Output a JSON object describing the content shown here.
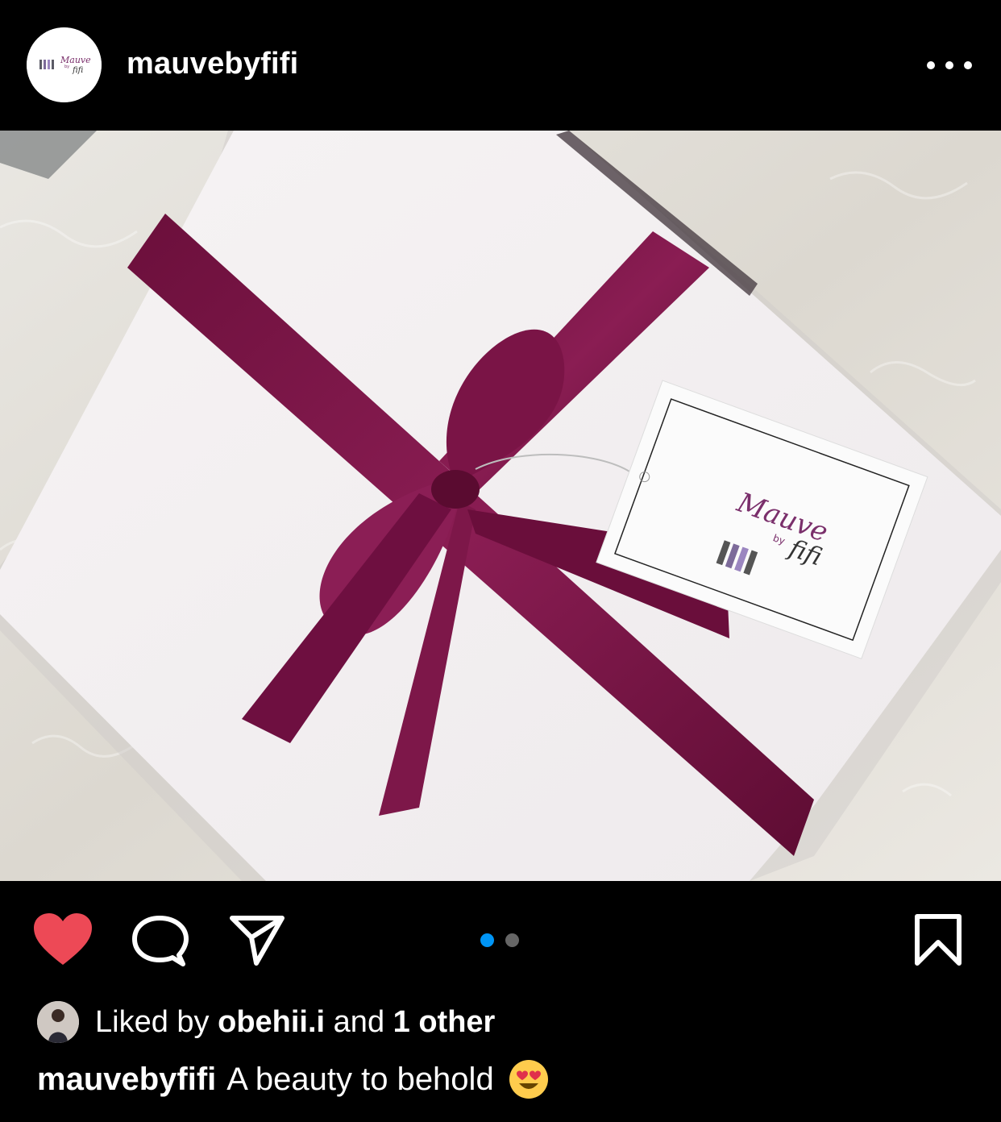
{
  "header": {
    "username": "mauvebyfifi",
    "avatar_logo": {
      "script_text": "Mauve",
      "small_text": "by",
      "name_text": "fifi"
    },
    "more_icon": "more-horizontal-icon"
  },
  "photo": {
    "tag_text": {
      "brand": "Mauve",
      "by": "by",
      "name": "fifi"
    }
  },
  "actions": {
    "like_icon": "heart-filled-icon",
    "comment_icon": "comment-icon",
    "share_icon": "paper-plane-icon",
    "save_icon": "bookmark-icon",
    "carousel": {
      "count": 2,
      "active": 0
    }
  },
  "likes": {
    "prefix": "Liked by",
    "user": "obehii.i",
    "conjunction": "and",
    "others": "1 other"
  },
  "caption": {
    "username": "mauvebyfifi",
    "text": "A beauty to behold",
    "emoji": "😍"
  },
  "colors": {
    "background": "#000000",
    "like_red": "#ED4956",
    "carousel_active": "#0095F6",
    "carousel_inactive": "#666666",
    "ribbon": "#7A1446"
  }
}
